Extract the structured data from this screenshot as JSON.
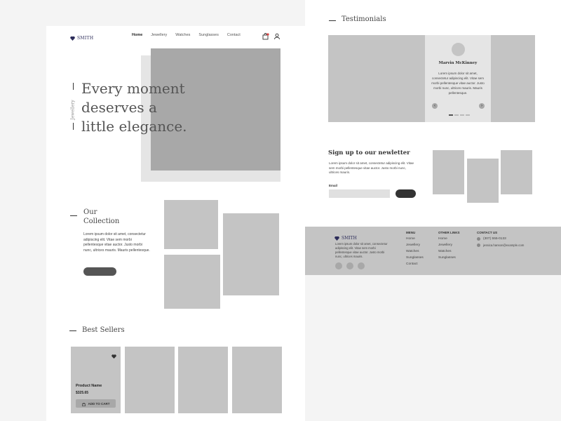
{
  "header": {
    "brand": "SMITH",
    "nav": [
      "Home",
      "Jewellery",
      "Watches",
      "Sunglasses",
      "Contact"
    ]
  },
  "hero": {
    "side_label": "Jewellery",
    "headline_1": "Every moment",
    "headline_2": "deserves a",
    "headline_3": "little elegance."
  },
  "collection": {
    "title_1": "Our",
    "title_2": "Collection",
    "text": "Lorem ipsum dolor sit amet, consectetur adipiscing elit. Vitae sem morbi pellentesque vitae auctor. Justo morbi nunc, ultrices mauris. Mauris pellentesque."
  },
  "best_sellers": {
    "title": "Best Sellers",
    "product_name": "Product Name",
    "product_price": "$325.65",
    "add_to_cart": "ADD TO CART"
  },
  "testimonials": {
    "title": "Testimonials",
    "name": "Marvin McKinney",
    "quote": "Lorem ipsum dolor sit amet, consectetur adipiscing elit. Vitae sem morbi pellentesque vitae auctor. Justo morbi nunc, ultrices mauris. Mauris pellentesque.",
    "prev": "‹",
    "next": "›"
  },
  "newsletter": {
    "title": "Sign up to our newletter",
    "text": "Lorem ipsum dolor sit amet, consectetur adipiscing elit. Vitae sem morbi pellentesque vitae auctor. Justo morbi nunc, ultrices mauris.",
    "email_label": "Email"
  },
  "footer": {
    "brand": "SMITH",
    "text": "Lorem ipsum dolor sit amet, consectetur adipiscing elit. Vitae sem morbi pellentesque vitae auctor. Justo morbi nunc, ultrices mauris.",
    "menu_title": "MENU",
    "menu": [
      "Home",
      "Jewellery",
      "Watches",
      "Sunglasses",
      "Contact"
    ],
    "other_title": "OTHER LINKS",
    "other": [
      "Home",
      "Jewellery",
      "Watches",
      "Sunglasses"
    ],
    "contact_title": "CONTACT US",
    "phone": "(307) 555-0133",
    "email": "jessica.hanson@example.com"
  },
  "colors": {
    "page_bg": "#f4f4f4",
    "footer_bg": "#c4c4c4",
    "placeholder": "#c4c4c4",
    "dark_button": "#555555"
  }
}
